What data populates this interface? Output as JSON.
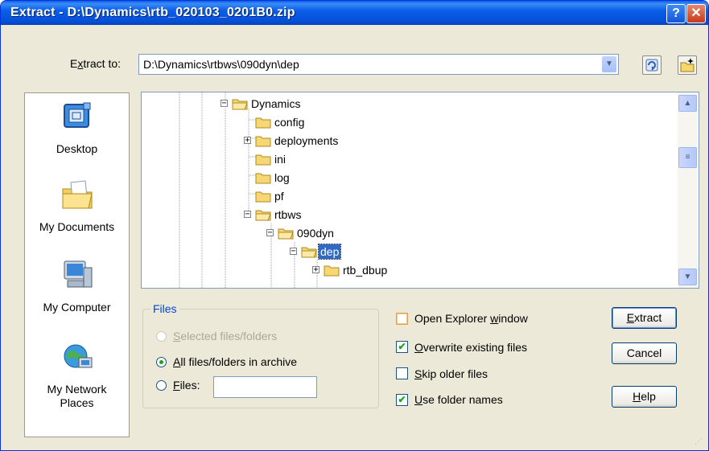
{
  "window": {
    "title": "Extract - D:\\Dynamics\\rtb_020103_0201B0.zip",
    "help_glyph": "?",
    "close_glyph": "✕"
  },
  "extract_to": {
    "label_prefix": "E",
    "label_accel": "x",
    "label_suffix": "tract to:",
    "path": "D:\\Dynamics\\rtbws\\090dyn\\dep",
    "dropdown_icon": "chevron-down-icon"
  },
  "toolbar": {
    "refresh_icon": "refresh-folder-icon",
    "new_folder_icon": "new-folder-icon"
  },
  "places": [
    {
      "label_line1": "Desktop",
      "label_line2": "",
      "icon": "desktop-icon"
    },
    {
      "label_line1": "My Documents",
      "label_line2": "",
      "icon": "my-documents-icon"
    },
    {
      "label_line1": "My Computer",
      "label_line2": "",
      "icon": "my-computer-icon"
    },
    {
      "label_line1": "My Network",
      "label_line2": "Places",
      "icon": "my-network-places-icon"
    }
  ],
  "tree": {
    "nodes": [
      {
        "label": "Dynamics",
        "expander": "−",
        "selected": false
      },
      {
        "label": "config",
        "expander": "",
        "selected": false
      },
      {
        "label": "deployments",
        "expander": "+",
        "selected": false
      },
      {
        "label": "ini",
        "expander": "",
        "selected": false
      },
      {
        "label": "log",
        "expander": "",
        "selected": false
      },
      {
        "label": "pf",
        "expander": "",
        "selected": false
      },
      {
        "label": "rtbws",
        "expander": "−",
        "selected": false
      },
      {
        "label": "090dyn",
        "expander": "−",
        "selected": false
      },
      {
        "label": "dep",
        "expander": "−",
        "selected": true
      },
      {
        "label": "rtb_dbup",
        "expander": "+",
        "selected": false
      }
    ],
    "scroll_up": "▲",
    "scroll_down": "▼"
  },
  "files_group": {
    "legend": "Files",
    "selected_prefix": "",
    "selected_accel": "S",
    "selected_suffix": "elected files/folders",
    "all_prefix": "",
    "all_accel": "A",
    "all_suffix": "ll files/folders in archive",
    "files_prefix": "",
    "files_accel": "F",
    "files_suffix": "iles:",
    "files_value": "",
    "selected_state": "disabled",
    "all_state": "checked",
    "files_state": "unchecked"
  },
  "options": {
    "open_explorer_prefix": "Open Explorer ",
    "open_explorer_accel": "w",
    "open_explorer_suffix": "indow",
    "open_explorer_checked": false,
    "overwrite_prefix": "",
    "overwrite_accel": "O",
    "overwrite_suffix": "verwrite existing files",
    "overwrite_checked": true,
    "skip_prefix": "",
    "skip_accel": "S",
    "skip_suffix": "kip older files",
    "skip_checked": false,
    "use_folder_prefix": "",
    "use_folder_accel": "U",
    "use_folder_suffix": "se folder names",
    "use_folder_checked": true,
    "check_glyph": "✔"
  },
  "buttons": {
    "extract_prefix": "",
    "extract_accel": "E",
    "extract_suffix": "xtract",
    "cancel_label": "Cancel",
    "help_prefix": "",
    "help_accel": "H",
    "help_suffix": "elp"
  },
  "colors": {
    "title_blue": "#0550d8",
    "dialog_bg": "#ece9d8",
    "selection": "#316ac5",
    "group_legend": "#0046d5",
    "check_green": "#21a121"
  }
}
